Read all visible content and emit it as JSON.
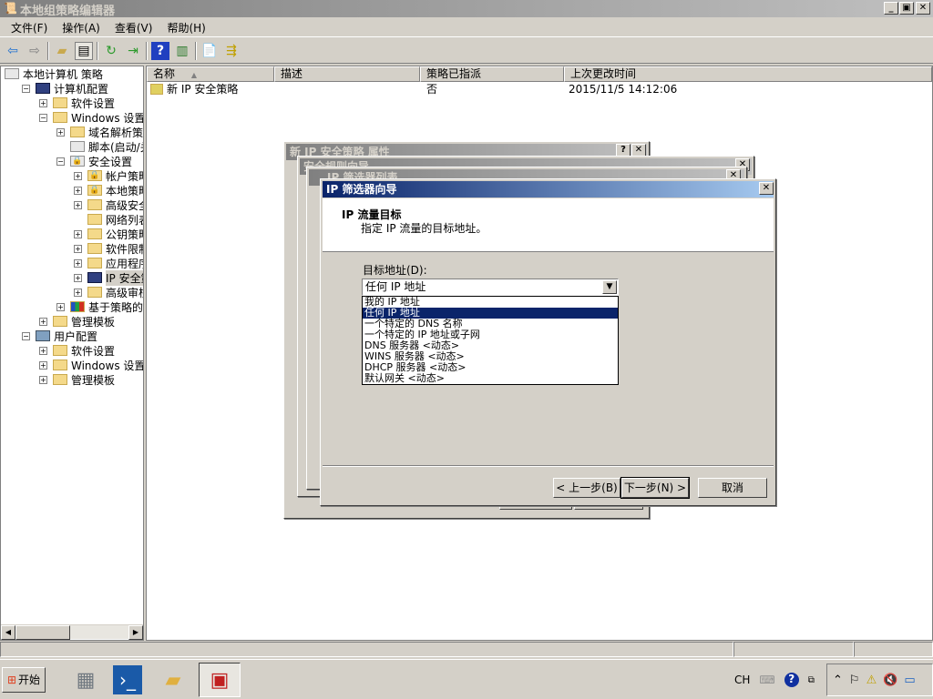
{
  "window": {
    "title": "本地组策略编辑器",
    "minimize": "_",
    "restore": "▣",
    "close": "✕"
  },
  "menu": [
    "文件(F)",
    "操作(A)",
    "查看(V)",
    "帮助(H)"
  ],
  "toolbar": [
    "back-icon",
    "forward-icon",
    "up-folder-icon",
    "show-hide-tree-icon",
    "refresh-icon",
    "export-list-icon",
    "help-icon",
    "show-hide-action-icon",
    "new-policy-icon",
    "assign-icon"
  ],
  "tree": [
    {
      "label": "本地计算机 策略",
      "depth": 0,
      "exp": "",
      "icon": "policy-icon"
    },
    {
      "label": "计算机配置",
      "depth": 1,
      "exp": "−",
      "icon": "computer-icon"
    },
    {
      "label": "软件设置",
      "depth": 2,
      "exp": "+",
      "icon": "folder-icon"
    },
    {
      "label": "Windows 设置",
      "depth": 2,
      "exp": "−",
      "icon": "folder-icon"
    },
    {
      "label": "域名解析策略",
      "depth": 3,
      "exp": "+",
      "icon": "folder-icon"
    },
    {
      "label": "脚本(启动/关",
      "depth": 3,
      "exp": "",
      "icon": "script-icon"
    },
    {
      "label": "安全设置",
      "depth": 3,
      "exp": "−",
      "icon": "security-icon"
    },
    {
      "label": "帐户策略",
      "depth": 4,
      "exp": "+",
      "icon": "locked-folder-icon"
    },
    {
      "label": "本地策略",
      "depth": 4,
      "exp": "+",
      "icon": "locked-folder-icon"
    },
    {
      "label": "高级安全",
      "depth": 4,
      "exp": "+",
      "icon": "folder-icon"
    },
    {
      "label": "网络列表管",
      "depth": 4,
      "exp": "",
      "icon": "folder-icon"
    },
    {
      "label": "公钥策略",
      "depth": 4,
      "exp": "+",
      "icon": "folder-icon"
    },
    {
      "label": "软件限制策",
      "depth": 4,
      "exp": "+",
      "icon": "folder-icon"
    },
    {
      "label": "应用程序控",
      "depth": 4,
      "exp": "+",
      "icon": "folder-icon"
    },
    {
      "label": "IP 安全策",
      "depth": 4,
      "exp": "+",
      "icon": "ip-security-icon",
      "selected": true
    },
    {
      "label": "高级审核策",
      "depth": 4,
      "exp": "+",
      "icon": "folder-icon"
    },
    {
      "label": "基于策略的 Q",
      "depth": 3,
      "exp": "+",
      "icon": "qos-chart-icon"
    },
    {
      "label": "管理模板",
      "depth": 2,
      "exp": "+",
      "icon": "folder-icon"
    },
    {
      "label": "用户配置",
      "depth": 1,
      "exp": "−",
      "icon": "user-icon"
    },
    {
      "label": "软件设置",
      "depth": 2,
      "exp": "+",
      "icon": "folder-icon"
    },
    {
      "label": "Windows 设置",
      "depth": 2,
      "exp": "+",
      "icon": "folder-icon"
    },
    {
      "label": "管理模板",
      "depth": 2,
      "exp": "+",
      "icon": "folder-icon"
    }
  ],
  "list": {
    "columns": [
      "名称",
      "描述",
      "策略已指派",
      "上次更改时间"
    ],
    "rows": [
      {
        "name": "新 IP 安全策略",
        "desc": "",
        "assigned": "否",
        "modified": "2015/11/5 14:12:06"
      }
    ]
  },
  "dialogs": {
    "props": {
      "title": "新 IP 安全策略 属性",
      "help": "?",
      "close": "✕"
    },
    "rule_wizard": {
      "title": "安全规则向导",
      "close": "✕"
    },
    "filter_list": {
      "title": "IP 筛选器列表",
      "close": "✕"
    },
    "filter_wizard": {
      "title": "IP 筛选器向导",
      "close": "✕",
      "heading": "IP 流量目标",
      "subheading": "指定 IP 流量的目标地址。",
      "field_label": "目标地址(D):",
      "selected": "任何 IP 地址",
      "options": [
        "我的 IP 地址",
        "任何 IP 地址",
        "一个特定的 DNS 名称",
        "一个特定的 IP 地址或子网",
        "DNS 服务器 <动态>",
        "WINS 服务器 <动态>",
        "DHCP 服务器 <动态>",
        "默认网关 <动态>"
      ],
      "highlighted_index": 1,
      "back": "< 上一步(B)",
      "next": "下一步(N) >",
      "cancel": "取消"
    }
  },
  "taskbar": {
    "start": "开始",
    "lang": "CH"
  }
}
